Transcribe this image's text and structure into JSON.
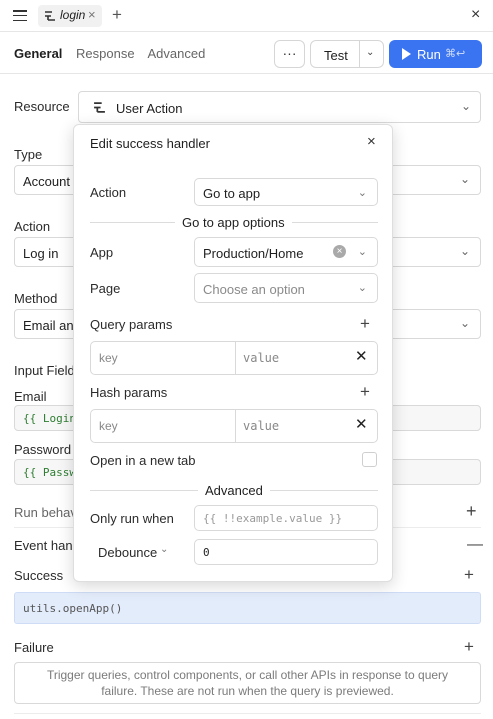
{
  "topbar": {
    "tab_label": "login",
    "tab_close": "×",
    "new_tab": "+",
    "close": "×"
  },
  "subnav": {
    "tabs": [
      "General",
      "Response",
      "Advanced"
    ],
    "more": "···",
    "test_label": "Test",
    "run_label": "Run",
    "run_shortcut": "⌘↩"
  },
  "form": {
    "resource_label": "Resource",
    "resource_value": "User Action",
    "type_label": "Type",
    "type_value": "Account",
    "action_label": "Action",
    "action_value": "Log in",
    "method_label": "Method",
    "method_value": "Email and",
    "input_fields_label": "Input Field",
    "email_label": "Email",
    "email_value": "{{ Login",
    "password_label": "Password",
    "password_value": "{{ Passw",
    "run_behavior_label": "Run behav",
    "event_handlers_label": "Event hand",
    "success_label": "Success",
    "success_handler": "utils.openApp()",
    "failure_label": "Failure",
    "failure_help": "Trigger queries, control components, or call other APIs in response to query failure. These are not run when the query is previewed."
  },
  "modal": {
    "title": "Edit success handler",
    "close": "×",
    "action_label": "Action",
    "action_value": "Go to app",
    "section_app_options": "Go to app options",
    "app_label": "App",
    "app_value": "Production/Home",
    "page_label": "Page",
    "page_placeholder": "Choose an option",
    "query_params_label": "Query params",
    "query_key_placeholder": "key",
    "query_value_placeholder": "value",
    "hash_params_label": "Hash params",
    "hash_key_placeholder": "key",
    "hash_value_placeholder": "value",
    "open_new_tab_label": "Open in a new tab",
    "section_advanced": "Advanced",
    "only_run_when_label": "Only run when",
    "only_run_when_placeholder": "{{ !!example.value }}",
    "debounce_label": "Debounce",
    "debounce_value": "0"
  }
}
